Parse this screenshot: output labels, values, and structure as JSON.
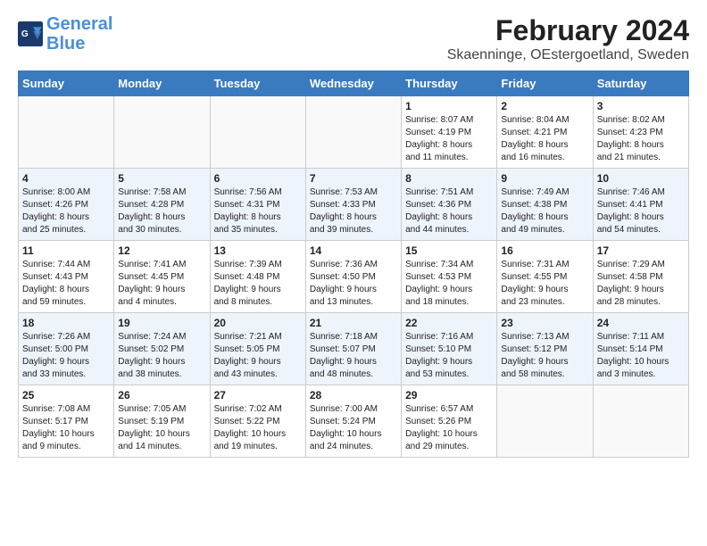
{
  "header": {
    "logo_line1": "General",
    "logo_line2": "Blue",
    "title": "February 2024",
    "subtitle": "Skaenninge, OEstergoetland, Sweden"
  },
  "weekdays": [
    "Sunday",
    "Monday",
    "Tuesday",
    "Wednesday",
    "Thursday",
    "Friday",
    "Saturday"
  ],
  "weeks": [
    [
      {
        "day": "",
        "info": ""
      },
      {
        "day": "",
        "info": ""
      },
      {
        "day": "",
        "info": ""
      },
      {
        "day": "",
        "info": ""
      },
      {
        "day": "1",
        "info": "Sunrise: 8:07 AM\nSunset: 4:19 PM\nDaylight: 8 hours\nand 11 minutes."
      },
      {
        "day": "2",
        "info": "Sunrise: 8:04 AM\nSunset: 4:21 PM\nDaylight: 8 hours\nand 16 minutes."
      },
      {
        "day": "3",
        "info": "Sunrise: 8:02 AM\nSunset: 4:23 PM\nDaylight: 8 hours\nand 21 minutes."
      }
    ],
    [
      {
        "day": "4",
        "info": "Sunrise: 8:00 AM\nSunset: 4:26 PM\nDaylight: 8 hours\nand 25 minutes."
      },
      {
        "day": "5",
        "info": "Sunrise: 7:58 AM\nSunset: 4:28 PM\nDaylight: 8 hours\nand 30 minutes."
      },
      {
        "day": "6",
        "info": "Sunrise: 7:56 AM\nSunset: 4:31 PM\nDaylight: 8 hours\nand 35 minutes."
      },
      {
        "day": "7",
        "info": "Sunrise: 7:53 AM\nSunset: 4:33 PM\nDaylight: 8 hours\nand 39 minutes."
      },
      {
        "day": "8",
        "info": "Sunrise: 7:51 AM\nSunset: 4:36 PM\nDaylight: 8 hours\nand 44 minutes."
      },
      {
        "day": "9",
        "info": "Sunrise: 7:49 AM\nSunset: 4:38 PM\nDaylight: 8 hours\nand 49 minutes."
      },
      {
        "day": "10",
        "info": "Sunrise: 7:46 AM\nSunset: 4:41 PM\nDaylight: 8 hours\nand 54 minutes."
      }
    ],
    [
      {
        "day": "11",
        "info": "Sunrise: 7:44 AM\nSunset: 4:43 PM\nDaylight: 8 hours\nand 59 minutes."
      },
      {
        "day": "12",
        "info": "Sunrise: 7:41 AM\nSunset: 4:45 PM\nDaylight: 9 hours\nand 4 minutes."
      },
      {
        "day": "13",
        "info": "Sunrise: 7:39 AM\nSunset: 4:48 PM\nDaylight: 9 hours\nand 8 minutes."
      },
      {
        "day": "14",
        "info": "Sunrise: 7:36 AM\nSunset: 4:50 PM\nDaylight: 9 hours\nand 13 minutes."
      },
      {
        "day": "15",
        "info": "Sunrise: 7:34 AM\nSunset: 4:53 PM\nDaylight: 9 hours\nand 18 minutes."
      },
      {
        "day": "16",
        "info": "Sunrise: 7:31 AM\nSunset: 4:55 PM\nDaylight: 9 hours\nand 23 minutes."
      },
      {
        "day": "17",
        "info": "Sunrise: 7:29 AM\nSunset: 4:58 PM\nDaylight: 9 hours\nand 28 minutes."
      }
    ],
    [
      {
        "day": "18",
        "info": "Sunrise: 7:26 AM\nSunset: 5:00 PM\nDaylight: 9 hours\nand 33 minutes."
      },
      {
        "day": "19",
        "info": "Sunrise: 7:24 AM\nSunset: 5:02 PM\nDaylight: 9 hours\nand 38 minutes."
      },
      {
        "day": "20",
        "info": "Sunrise: 7:21 AM\nSunset: 5:05 PM\nDaylight: 9 hours\nand 43 minutes."
      },
      {
        "day": "21",
        "info": "Sunrise: 7:18 AM\nSunset: 5:07 PM\nDaylight: 9 hours\nand 48 minutes."
      },
      {
        "day": "22",
        "info": "Sunrise: 7:16 AM\nSunset: 5:10 PM\nDaylight: 9 hours\nand 53 minutes."
      },
      {
        "day": "23",
        "info": "Sunrise: 7:13 AM\nSunset: 5:12 PM\nDaylight: 9 hours\nand 58 minutes."
      },
      {
        "day": "24",
        "info": "Sunrise: 7:11 AM\nSunset: 5:14 PM\nDaylight: 10 hours\nand 3 minutes."
      }
    ],
    [
      {
        "day": "25",
        "info": "Sunrise: 7:08 AM\nSunset: 5:17 PM\nDaylight: 10 hours\nand 9 minutes."
      },
      {
        "day": "26",
        "info": "Sunrise: 7:05 AM\nSunset: 5:19 PM\nDaylight: 10 hours\nand 14 minutes."
      },
      {
        "day": "27",
        "info": "Sunrise: 7:02 AM\nSunset: 5:22 PM\nDaylight: 10 hours\nand 19 minutes."
      },
      {
        "day": "28",
        "info": "Sunrise: 7:00 AM\nSunset: 5:24 PM\nDaylight: 10 hours\nand 24 minutes."
      },
      {
        "day": "29",
        "info": "Sunrise: 6:57 AM\nSunset: 5:26 PM\nDaylight: 10 hours\nand 29 minutes."
      },
      {
        "day": "",
        "info": ""
      },
      {
        "day": "",
        "info": ""
      }
    ]
  ]
}
